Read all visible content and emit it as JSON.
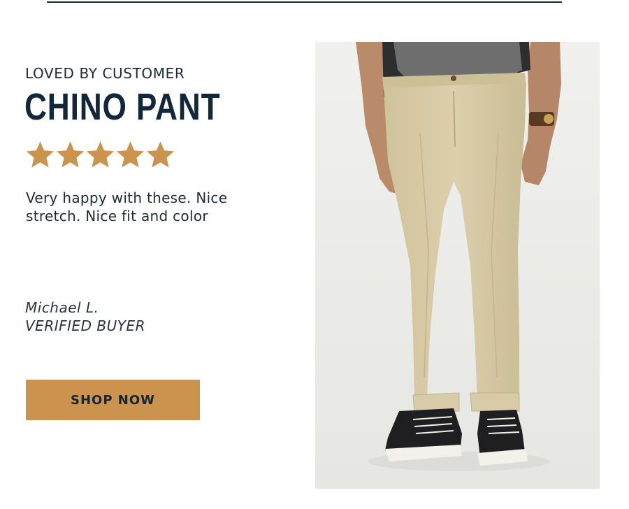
{
  "header": {
    "eyebrow": "LOVED BY CUSTOMER"
  },
  "product": {
    "title": "CHINO PANT"
  },
  "rating": {
    "value": 5,
    "max": 5,
    "color": "#cc934f"
  },
  "review": {
    "text": "Very happy with these. Nice stretch. Nice fit and color",
    "reviewer_name": "Michael L.",
    "reviewer_status": "VERIFIED BUYER"
  },
  "cta": {
    "label": "SHOP NOW",
    "color": "#cc934f"
  },
  "colors": {
    "title": "#13273a",
    "text": "#1c2b36",
    "divider": "#1d2a33"
  },
  "image": {
    "subject": "model-wearing-khaki-chino-pants"
  }
}
